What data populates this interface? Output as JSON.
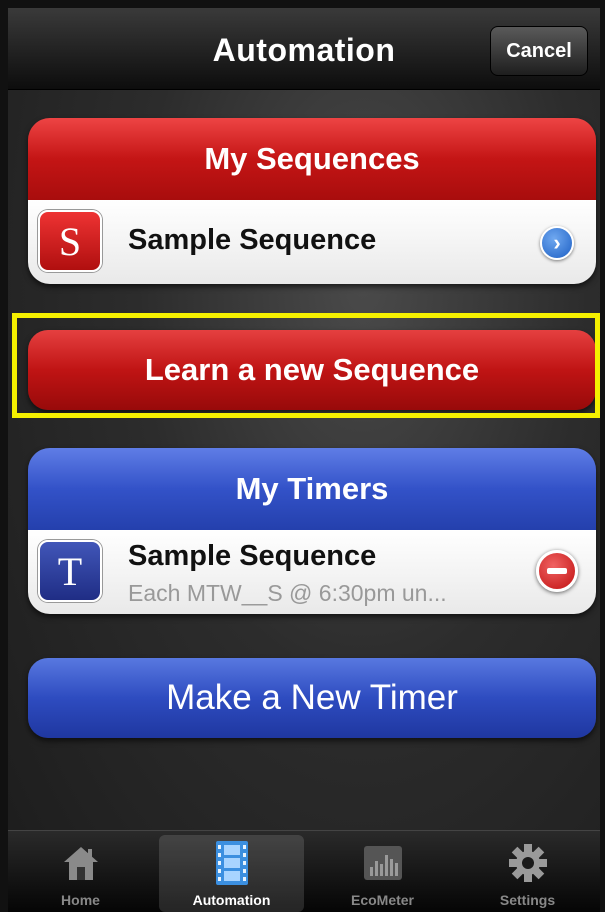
{
  "navbar": {
    "title": "Automation",
    "cancel_label": "Cancel"
  },
  "sequences": {
    "header": "My Sequences",
    "item": {
      "icon_letter": "S",
      "title": "Sample Sequence"
    }
  },
  "learn_button": "Learn a new Sequence",
  "timers": {
    "header": "My Timers",
    "item": {
      "icon_letter": "T",
      "title": "Sample Sequence",
      "subtitle": "Each MTW__S @ 6:30pm un..."
    }
  },
  "make_timer_button": "Make a New Timer",
  "tabs": [
    {
      "label": "Home",
      "icon": "home-icon",
      "active": false
    },
    {
      "label": "Automation",
      "icon": "film-strip-icon",
      "active": true
    },
    {
      "label": "EcoMeter",
      "icon": "bar-meter-icon",
      "active": false
    },
    {
      "label": "Settings",
      "icon": "gear-icon",
      "active": false
    }
  ],
  "colors": {
    "red": "#c41515",
    "blue": "#3352c8",
    "highlight": "#f5f000"
  }
}
